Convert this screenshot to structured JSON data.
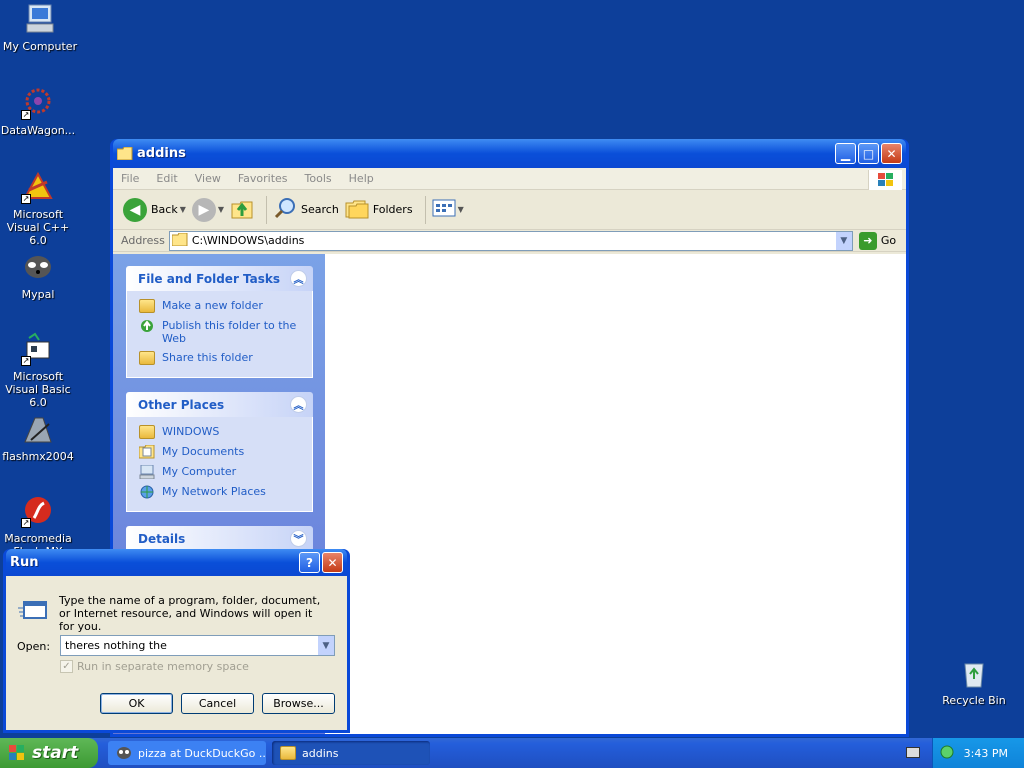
{
  "desktop": {
    "icons": [
      {
        "label": "My Computer"
      },
      {
        "label": "DataWagon..."
      },
      {
        "label": "Microsoft Visual C++ 6.0"
      },
      {
        "label": "Mypal"
      },
      {
        "label": "Microsoft Visual Basic 6.0"
      },
      {
        "label": "flashmx2004"
      },
      {
        "label": "Macromedia Flash MX 2004"
      },
      {
        "label": "Recycle Bin"
      }
    ]
  },
  "explorer": {
    "title": "addins",
    "menu": [
      "File",
      "Edit",
      "View",
      "Favorites",
      "Tools",
      "Help"
    ],
    "toolbar": {
      "back": "Back",
      "search": "Search",
      "folders": "Folders"
    },
    "address_label": "Address",
    "address_value": "C:\\WINDOWS\\addins",
    "go": "Go",
    "panels": {
      "file_tasks": {
        "title": "File and Folder Tasks",
        "items": [
          "Make a new folder",
          "Publish this folder to the Web",
          "Share this folder"
        ]
      },
      "other_places": {
        "title": "Other Places",
        "items": [
          "WINDOWS",
          "My Documents",
          "My Computer",
          "My Network Places"
        ]
      },
      "details": {
        "title": "Details"
      }
    }
  },
  "run_dialog": {
    "title": "Run",
    "description": "Type the name of a program, folder, document, or Internet resource, and Windows will open it for you.",
    "open_label": "Open:",
    "open_value": "theres nothing the",
    "checkbox_label": "Run in separate memory space",
    "ok": "OK",
    "cancel": "Cancel",
    "browse": "Browse..."
  },
  "taskbar": {
    "start": "start",
    "tasks": [
      "pizza at DuckDuckGo ...",
      "addins"
    ],
    "clock": "3:43 PM"
  }
}
